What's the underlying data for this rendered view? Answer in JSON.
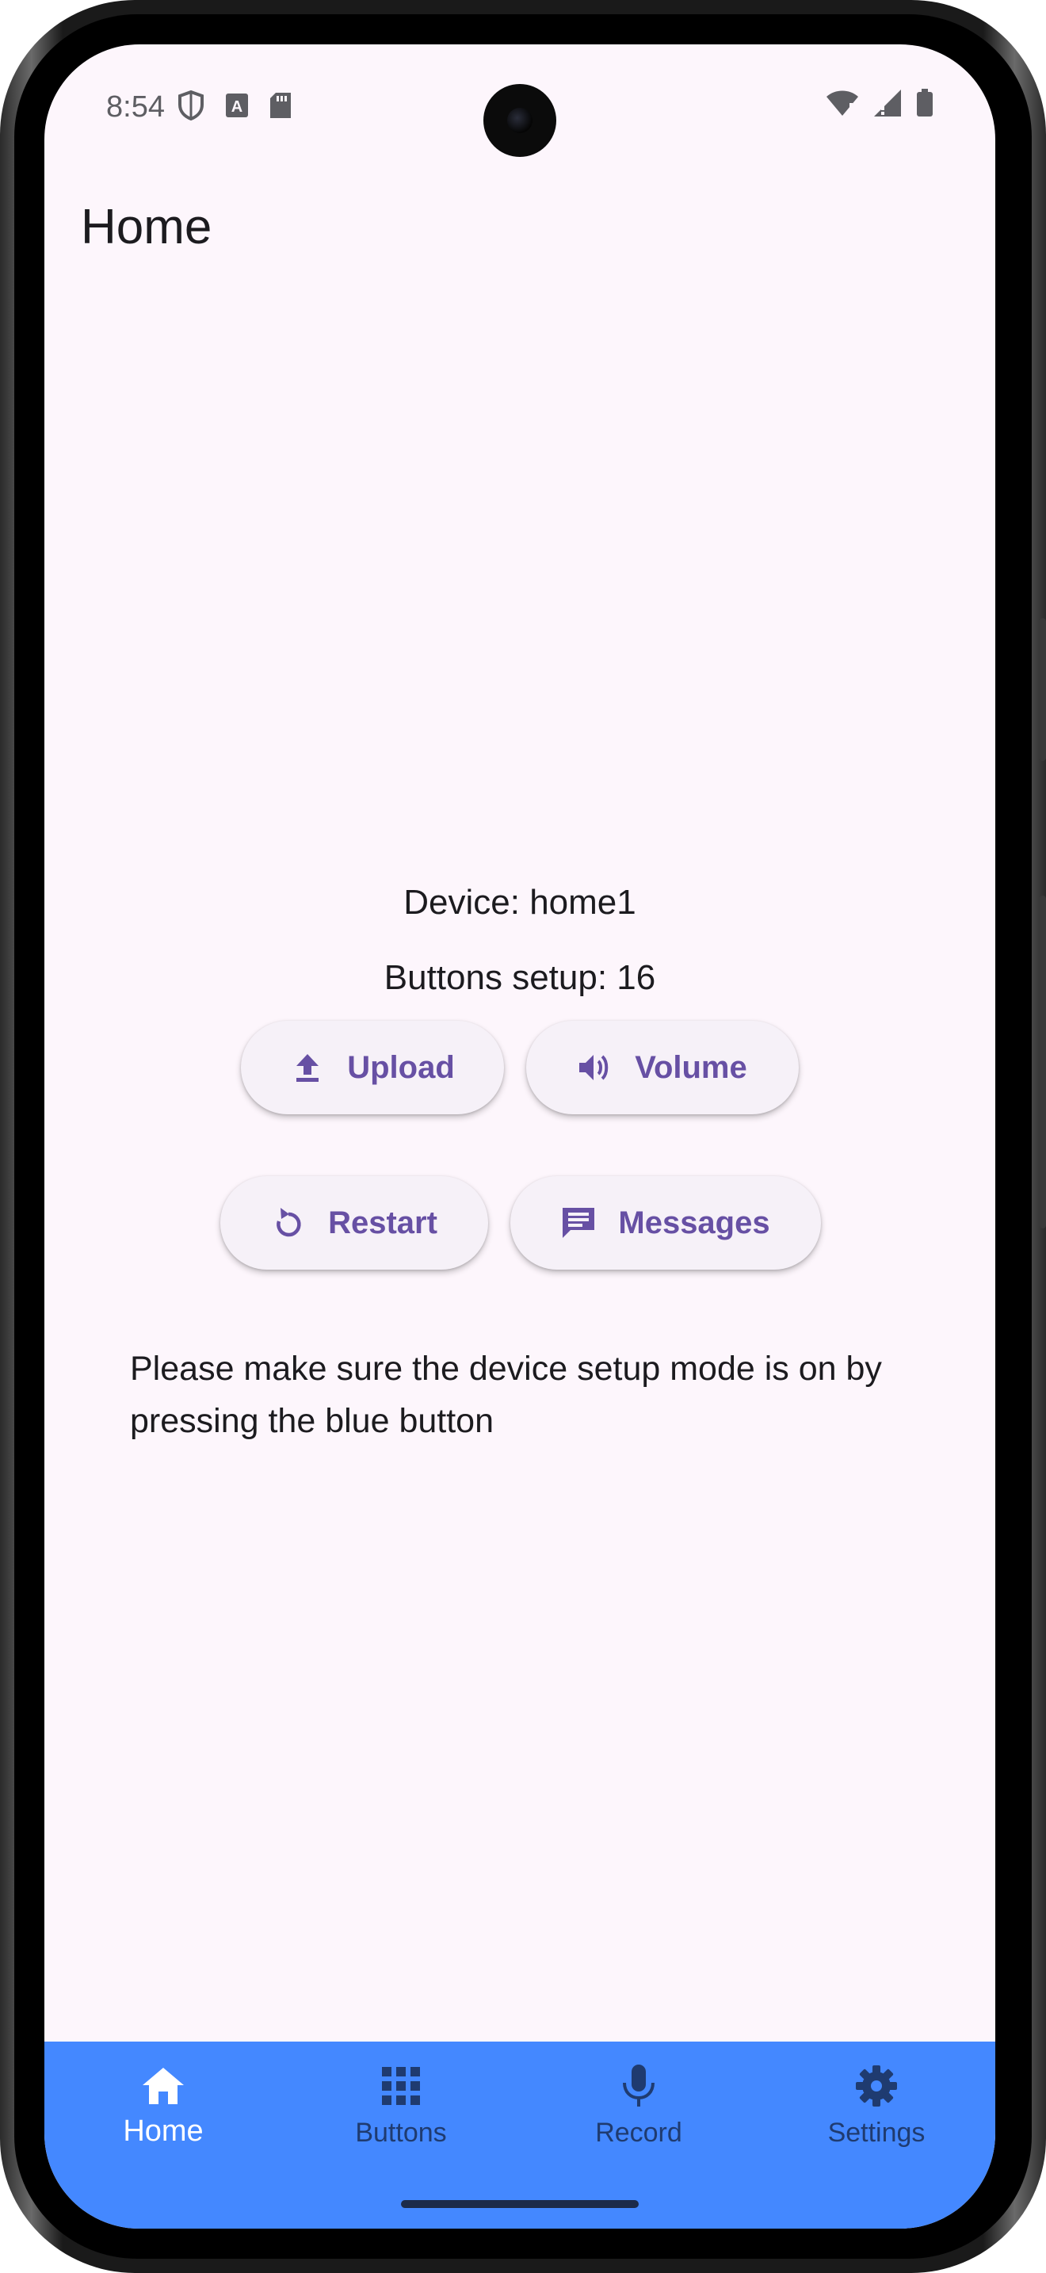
{
  "status_bar": {
    "time": "8:54",
    "left_icons": [
      "shield-icon",
      "text-a-icon",
      "sd-card-icon"
    ],
    "right_icons": [
      "wifi-alert-icon",
      "signal-alert-icon",
      "battery-icon"
    ]
  },
  "app_bar": {
    "title": "Home"
  },
  "main": {
    "device_text": "Device: home1",
    "buttons_setup_text": "Buttons setup: 16",
    "actions": [
      {
        "label": "Upload",
        "icon": "upload-icon"
      },
      {
        "label": "Volume",
        "icon": "volume-icon"
      },
      {
        "label": "Restart",
        "icon": "restart-icon"
      },
      {
        "label": "Messages",
        "icon": "message-icon"
      }
    ],
    "hint": "Please make sure the device setup mode is on by pressing the blue button"
  },
  "bottom_nav": {
    "items": [
      {
        "label": "Home",
        "icon": "home-icon",
        "selected": true
      },
      {
        "label": "Buttons",
        "icon": "grid-icon",
        "selected": false
      },
      {
        "label": "Record",
        "icon": "mic-icon",
        "selected": false
      },
      {
        "label": "Settings",
        "icon": "gear-icon",
        "selected": false
      }
    ]
  },
  "colors": {
    "background": "#fdf6fc",
    "accent": "#6750a4",
    "nav_background": "#4488ff",
    "nav_selected": "#ffffff",
    "nav_unselected": "#1f3b70"
  }
}
